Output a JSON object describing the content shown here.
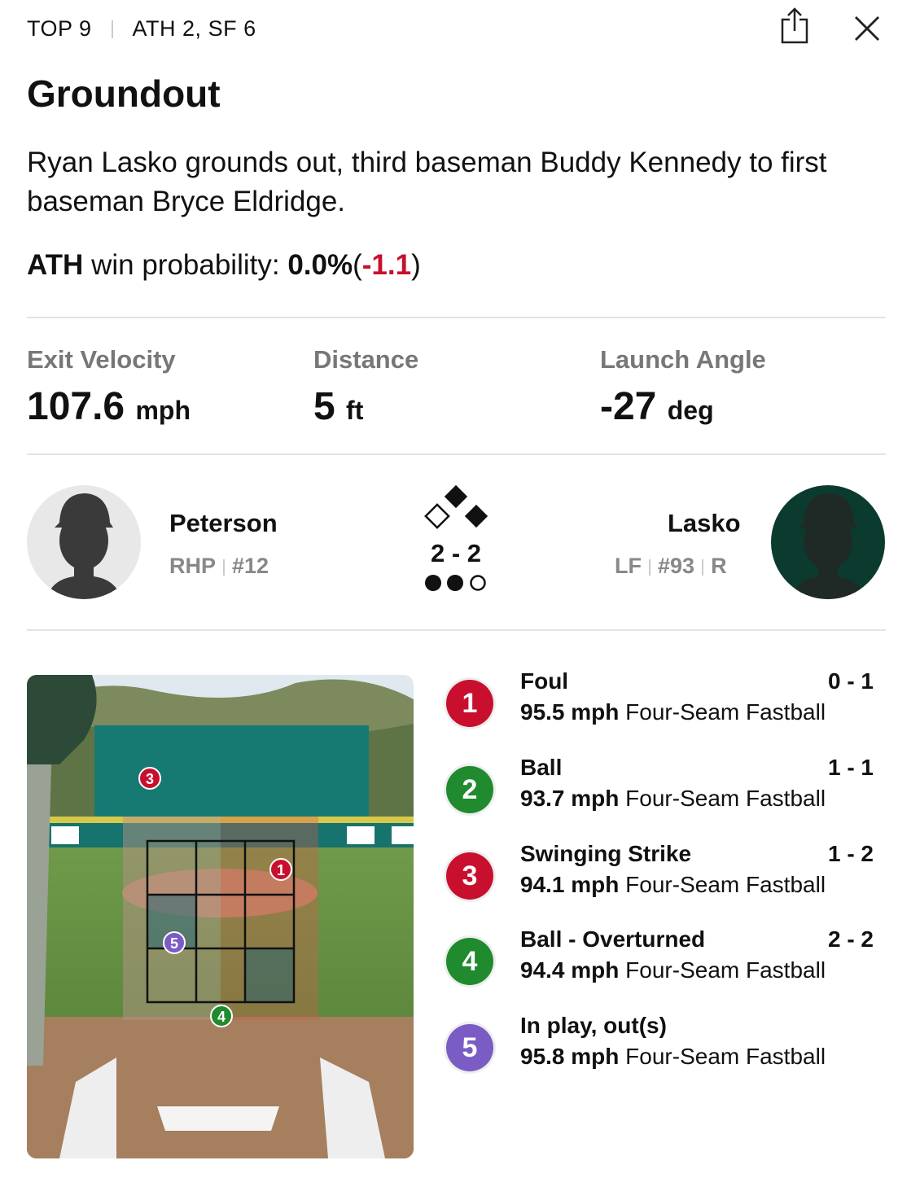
{
  "header": {
    "inning": "TOP 9",
    "score": "ATH 2, SF 6"
  },
  "play": {
    "title": "Groundout",
    "description": "Ryan Lasko grounds out, third baseman Buddy Kennedy to first baseman Bryce Eldridge.",
    "win_prob_team": "ATH",
    "win_prob_label": "win probability:",
    "win_prob_value": "0.0%",
    "win_prob_change": "-1.1"
  },
  "stats": [
    {
      "label": "Exit Velocity",
      "value": "107.6",
      "unit": "mph"
    },
    {
      "label": "Distance",
      "value": "5",
      "unit": "ft"
    },
    {
      "label": "Launch Angle",
      "value": "-27",
      "unit": "deg"
    }
  ],
  "pitcher": {
    "name": "Peterson",
    "pos": "RHP",
    "number": "#12"
  },
  "batter": {
    "name": "Lasko",
    "pos": "LF",
    "number": "#93",
    "bats": "R"
  },
  "count": "2 - 2",
  "outs": {
    "filled": 2,
    "total": 3
  },
  "colors": {
    "red": "#c8102e",
    "green": "#1f8a2e",
    "purple": "#7a5cc4",
    "athletics_green": "#0b3b2e"
  },
  "pitches": [
    {
      "num": "1",
      "result": "Foul",
      "count": "0 - 1",
      "speed": "95.5 mph",
      "type": "Four-Seam Fastball",
      "color": "#c8102e"
    },
    {
      "num": "2",
      "result": "Ball",
      "count": "1 - 1",
      "speed": "93.7 mph",
      "type": "Four-Seam Fastball",
      "color": "#1f8a2e"
    },
    {
      "num": "3",
      "result": "Swinging Strike",
      "count": "1 - 2",
      "speed": "94.1 mph",
      "type": "Four-Seam Fastball",
      "color": "#c8102e"
    },
    {
      "num": "4",
      "result": "Ball - Overturned",
      "count": "2 - 2",
      "speed": "94.4 mph",
      "type": "Four-Seam Fastball",
      "color": "#1f8a2e"
    },
    {
      "num": "5",
      "result": "In play, out(s)",
      "count": "",
      "speed": "95.8 mph",
      "type": "Four-Seam Fastball",
      "color": "#7a5cc4"
    }
  ]
}
